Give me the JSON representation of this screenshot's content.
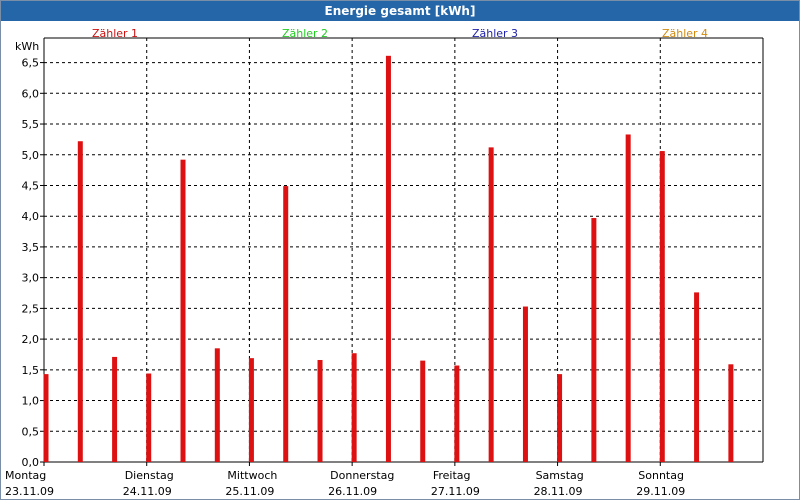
{
  "window": {
    "title": "Energie gesamt [kWh]"
  },
  "chart_data": {
    "type": "bar",
    "title": "Energie gesamt [kWh]",
    "ylabel": "kWh",
    "ylim": [
      0,
      6.9
    ],
    "yticks": [
      "0,0",
      "0,5",
      "1,0",
      "1,5",
      "2,0",
      "2,5",
      "3,0",
      "3,5",
      "4,0",
      "4,5",
      "5,0",
      "5,5",
      "6,0",
      "6,5"
    ],
    "legend": {
      "placement": "top",
      "entries": [
        {
          "name": "Zähler 1",
          "color": "#cc1111"
        },
        {
          "name": "Zähler 2",
          "color": "#22cc22"
        },
        {
          "name": "Zähler 3",
          "color": "#2222aa"
        },
        {
          "name": "Zähler 4",
          "color": "#d08a10"
        }
      ]
    },
    "categories": [
      {
        "day": "Montag",
        "date": "23.11.09"
      },
      {
        "day": "Dienstag",
        "date": "24.11.09"
      },
      {
        "day": "Mittwoch",
        "date": "25.11.09"
      },
      {
        "day": "Donnerstag",
        "date": "26.11.09"
      },
      {
        "day": "Freitag",
        "date": "27.11.09"
      },
      {
        "day": "Samstag",
        "date": "28.11.09"
      },
      {
        "day": "Sonntag",
        "date": "29.11.09"
      }
    ],
    "bar_color": "#dd1111",
    "grid": true,
    "values": [
      [
        1.43,
        5.22,
        1.71
      ],
      [
        1.44,
        4.92,
        1.85
      ],
      [
        1.69,
        4.49,
        1.66
      ],
      [
        1.77,
        6.61,
        1.65
      ],
      [
        1.57,
        5.12,
        2.53
      ],
      [
        1.43,
        3.97,
        5.33
      ],
      [
        5.06,
        2.76,
        1.59
      ]
    ]
  }
}
